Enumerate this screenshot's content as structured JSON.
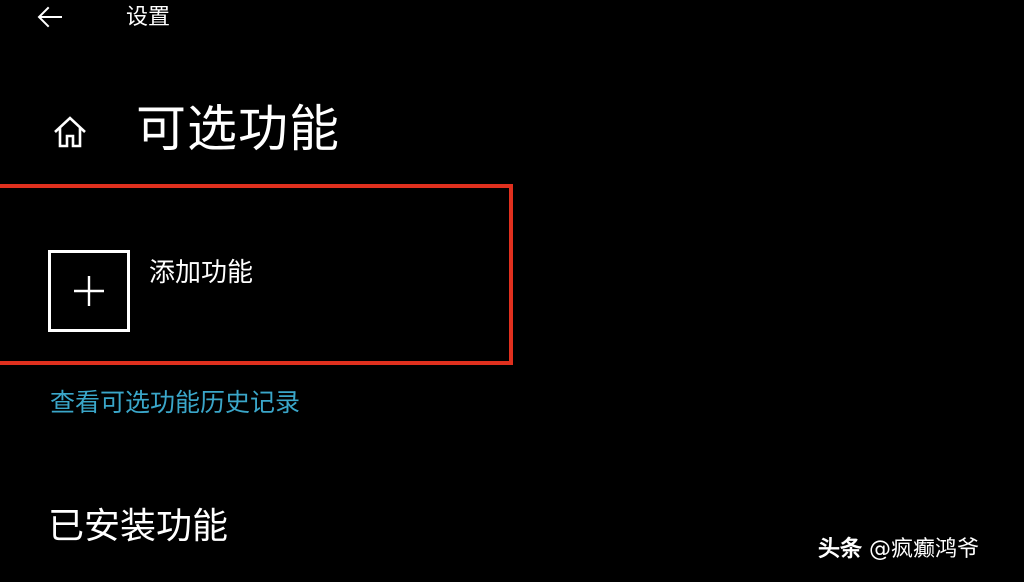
{
  "titlebar": {
    "back_icon": "back-arrow-icon",
    "app_title": "设置"
  },
  "header": {
    "home_icon": "home-icon",
    "title": "可选功能"
  },
  "add_feature": {
    "icon": "plus-icon",
    "label": "添加功能"
  },
  "highlight": {
    "color": "#e0301e"
  },
  "history_link": {
    "label": "查看可选功能历史记录",
    "color": "#3aa6c9"
  },
  "installed": {
    "heading": "已安装功能"
  },
  "watermark": {
    "brand": "头条",
    "author": "@疯癫鸿爷"
  }
}
